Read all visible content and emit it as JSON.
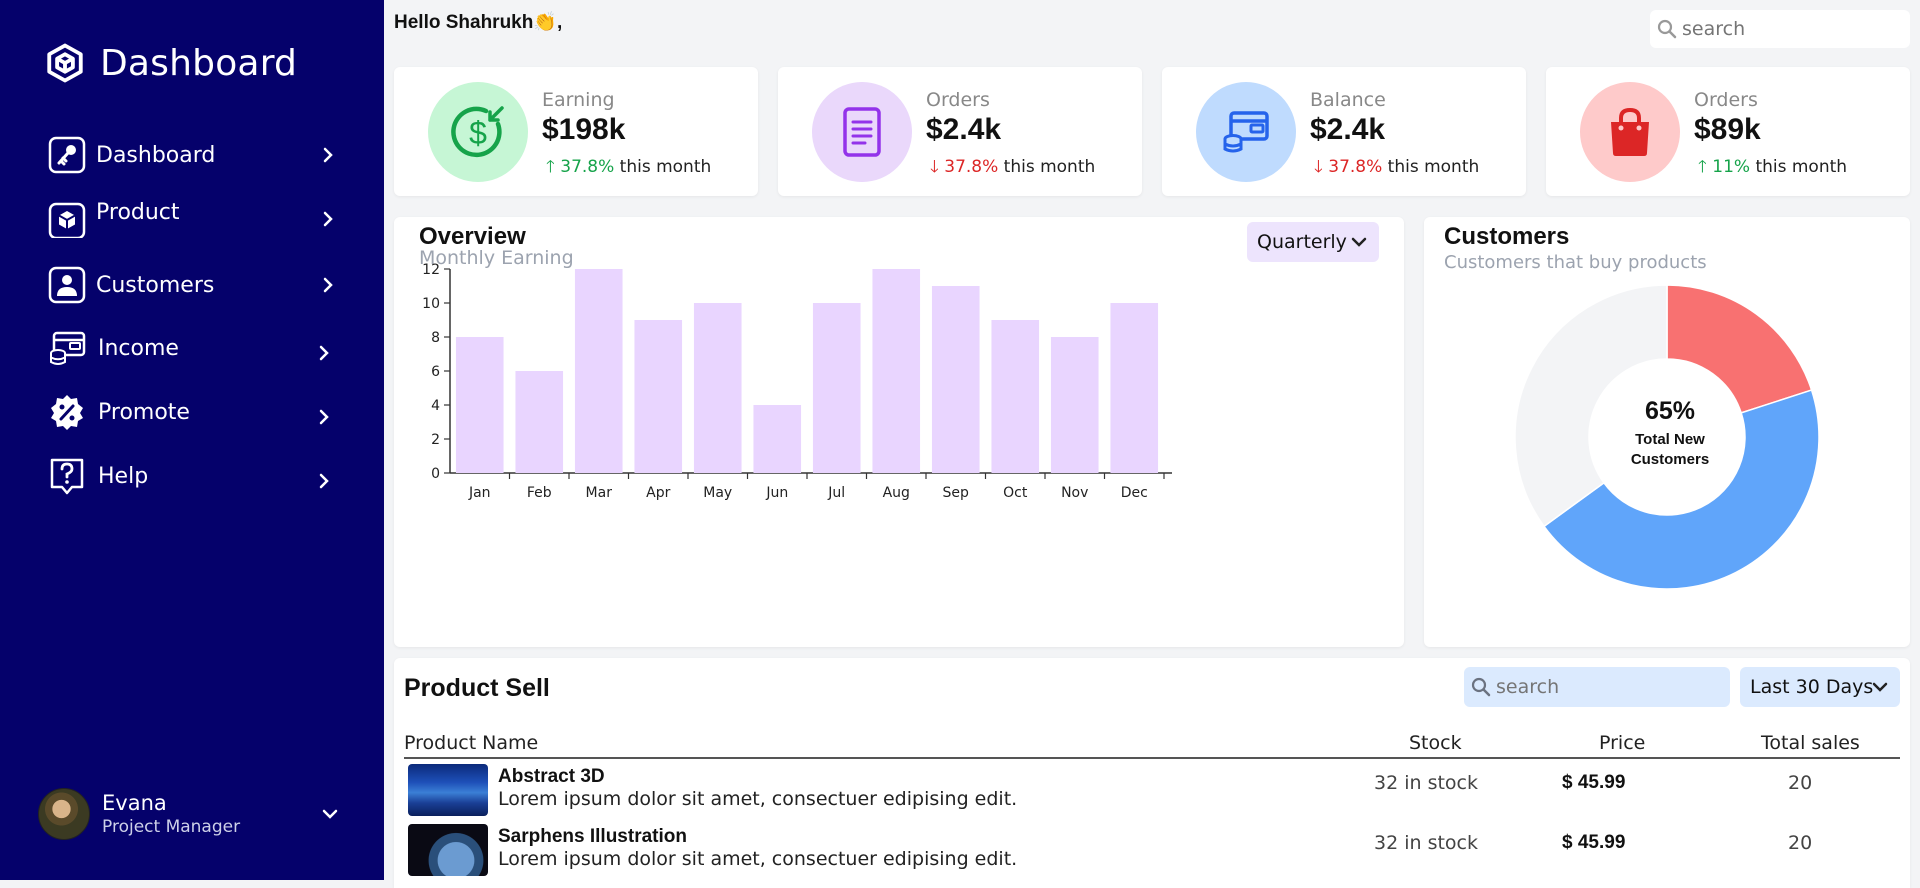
{
  "sidebar": {
    "brand": "Dashboard",
    "items": [
      {
        "label": "Dashboard",
        "icon": "key-icon"
      },
      {
        "label": "Product",
        "icon": "cube-icon"
      },
      {
        "label": "Customers",
        "icon": "user-icon"
      },
      {
        "label": "Income",
        "icon": "wallet-icon"
      },
      {
        "label": "Promote",
        "icon": "percent-badge-icon"
      },
      {
        "label": "Help",
        "icon": "question-icon"
      }
    ],
    "user": {
      "name": "Evana",
      "role": "Project Manager"
    }
  },
  "header": {
    "greeting": "Hello Shahrukh👏,",
    "search_placeholder": "search"
  },
  "stats": [
    {
      "label": "Earning",
      "value": "$198k",
      "trend_value": "37.8%",
      "trend_dir": "up",
      "trend_suffix": " this month",
      "icon": "dollar-icon",
      "circle_color": "#c6f6d5",
      "icon_color": "#16a34a"
    },
    {
      "label": "Orders",
      "value": "$2.4k",
      "trend_value": "37.8%",
      "trend_dir": "down",
      "trend_suffix": " this month",
      "icon": "document-icon",
      "circle_color": "#ead8fb",
      "icon_color": "#9333ea"
    },
    {
      "label": "Balance",
      "value": "$2.4k",
      "trend_value": "37.8%",
      "trend_dir": "down",
      "trend_suffix": " this month",
      "icon": "wallet-icon",
      "circle_color": "#bfdbfe",
      "icon_color": "#2563eb"
    },
    {
      "label": "Orders",
      "value": "$89k",
      "trend_value": "11%",
      "trend_dir": "up",
      "trend_suffix": " this month",
      "icon": "shopping-bag-icon",
      "circle_color": "#fecaca",
      "icon_color": "#dc2626"
    }
  ],
  "overview": {
    "title": "Overview",
    "subtitle": "Monthly Earning",
    "period": "Quarterly"
  },
  "chart_data": [
    {
      "type": "bar",
      "title": "Overview",
      "subtitle": "Monthly Earning",
      "categories": [
        "Jan",
        "Feb",
        "Mar",
        "Apr",
        "May",
        "Jun",
        "Jul",
        "Aug",
        "Sep",
        "Oct",
        "Nov",
        "Dec"
      ],
      "values": [
        8,
        6,
        12,
        9,
        10,
        4,
        10,
        12,
        11,
        9,
        8,
        10
      ],
      "yticks": [
        0,
        2,
        4,
        6,
        8,
        10,
        12
      ],
      "ylim": [
        0,
        12
      ],
      "xlabel": "",
      "ylabel": "",
      "color": "#e9d5ff",
      "grid": false
    },
    {
      "type": "pie",
      "title": "Customers",
      "subtitle": "Customers that buy products",
      "style": "donut",
      "slices": [
        {
          "value": 20,
          "color": "#f87171"
        },
        {
          "value": 45,
          "color": "#60a5fa"
        },
        {
          "value": 35,
          "color": "#f3f4f6"
        }
      ],
      "center_value": "65%",
      "center_label": "Total New Customers"
    }
  ],
  "customers": {
    "title": "Customers",
    "subtitle": "Customers that buy products",
    "center_value": "65%",
    "center_label": "Total New Customers"
  },
  "products": {
    "title": "Product Sell",
    "search_placeholder": "search",
    "period": "Last 30 Days",
    "columns": [
      "Product Name",
      "Stock",
      "Price",
      "Total sales"
    ],
    "rows": [
      {
        "name": "Abstract 3D",
        "desc": "Lorem ipsum dolor sit amet, consectuer edipising edit.",
        "stock": "32 in stock",
        "price": "$ 45.99",
        "sales": "20"
      },
      {
        "name": "Sarphens Illustration",
        "desc": "Lorem ipsum dolor sit amet, consectuer edipising edit.",
        "stock": "32 in stock",
        "price": "$ 45.99",
        "sales": "20"
      }
    ]
  },
  "colors": {
    "sidebar_bg": "#05016b",
    "bar": "#e9d5ff",
    "up": "#16a34a",
    "down": "#dc2626"
  }
}
